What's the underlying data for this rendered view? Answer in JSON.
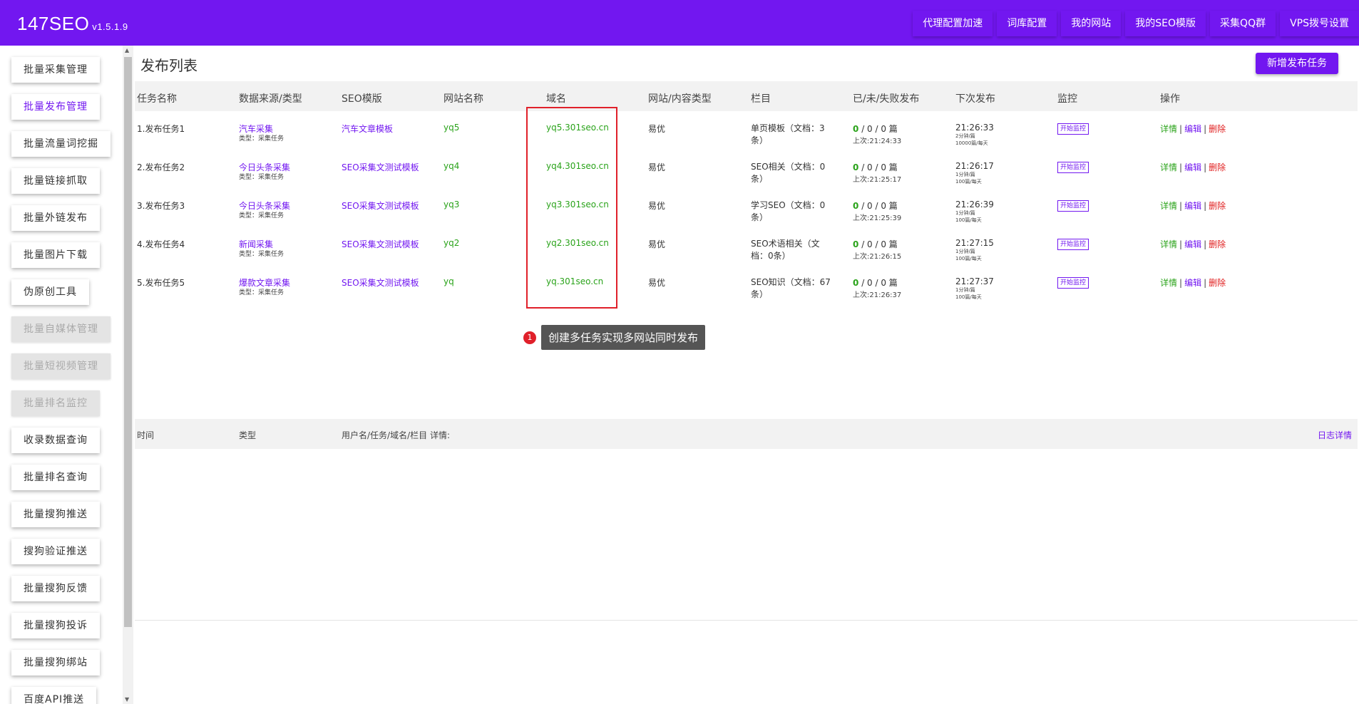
{
  "app": {
    "name": "147SEO",
    "version": "v1.5.1.9"
  },
  "topnav": [
    "代理配置加速",
    "词库配置",
    "我的网站",
    "我的SEO模版",
    "采集QQ群",
    "VPS拨号设置"
  ],
  "sidebar": [
    {
      "label": "批量采集管理",
      "state": "normal"
    },
    {
      "label": "批量发布管理",
      "state": "active"
    },
    {
      "label": "批量流量词挖掘",
      "state": "normal"
    },
    {
      "label": "批量链接抓取",
      "state": "normal"
    },
    {
      "label": "批量外链发布",
      "state": "normal"
    },
    {
      "label": "批量图片下载",
      "state": "normal"
    },
    {
      "label": "伪原创工具",
      "state": "normal"
    },
    {
      "label": "批量自媒体管理",
      "state": "disabled"
    },
    {
      "label": "批量短视频管理",
      "state": "disabled"
    },
    {
      "label": "批量排名监控",
      "state": "disabled"
    },
    {
      "label": "收录数据查询",
      "state": "normal"
    },
    {
      "label": "批量排名查询",
      "state": "normal"
    },
    {
      "label": "批量搜狗推送",
      "state": "normal"
    },
    {
      "label": "搜狗验证推送",
      "state": "normal"
    },
    {
      "label": "批量搜狗反馈",
      "state": "normal"
    },
    {
      "label": "批量搜狗投诉",
      "state": "normal"
    },
    {
      "label": "批量搜狗绑站",
      "state": "normal"
    },
    {
      "label": "百度API推送",
      "state": "normal"
    }
  ],
  "main": {
    "title": "发布列表",
    "add_button": "新增发布任务",
    "columns": [
      "任务名称",
      "数据来源/类型",
      "SEO模版",
      "网站名称",
      "域名",
      "网站/内容类型",
      "栏目",
      "已/未/失败发布",
      "下次发布",
      "监控",
      "操作"
    ],
    "rows": [
      {
        "task": "1.发布任务1",
        "source": "汽车采集",
        "source_type": "类型：采集任务",
        "template": "汽车文章模板",
        "site": "yq5",
        "domain": "yq5.301seo.cn",
        "content_type": "易优",
        "column_l1": "单页模板（文档：3",
        "column_l2": "条）",
        "pub_ok": "0",
        "pub_rest": "/ 0 / 0 篇",
        "last": "上次:21:24:33",
        "next": "21:26:33",
        "freq1": "2分钟/篇",
        "freq2": "10000篇/每天",
        "monitor": "开始监控",
        "op_detail": "详情",
        "op_edit": "编辑",
        "op_delete": "删除"
      },
      {
        "task": "2.发布任务2",
        "source": "今日头条采集",
        "source_type": "类型：采集任务",
        "template": "SEO采集文测试模板",
        "site": "yq4",
        "domain": "yq4.301seo.cn",
        "content_type": "易优",
        "column_l1": "SEO相关（文档：0",
        "column_l2": "条）",
        "pub_ok": "0",
        "pub_rest": "/ 0 / 0 篇",
        "last": "上次:21:25:17",
        "next": "21:26:17",
        "freq1": "1分钟/篇",
        "freq2": "100篇/每天",
        "monitor": "开始监控",
        "op_detail": "详情",
        "op_edit": "编辑",
        "op_delete": "删除"
      },
      {
        "task": "3.发布任务3",
        "source": "今日头条采集",
        "source_type": "类型：采集任务",
        "template": "SEO采集文测试模板",
        "site": "yq3",
        "domain": "yq3.301seo.cn",
        "content_type": "易优",
        "column_l1": "学习SEO（文档：0",
        "column_l2": "条）",
        "pub_ok": "0",
        "pub_rest": "/ 0 / 0 篇",
        "last": "上次:21:25:39",
        "next": "21:26:39",
        "freq1": "1分钟/篇",
        "freq2": "100篇/每天",
        "monitor": "开始监控",
        "op_detail": "详情",
        "op_edit": "编辑",
        "op_delete": "删除"
      },
      {
        "task": "4.发布任务4",
        "source": "新闻采集",
        "source_type": "类型：采集任务",
        "template": "SEO采集文测试模板",
        "site": "yq2",
        "domain": "yq2.301seo.cn",
        "content_type": "易优",
        "column_l1": "SEO术语相关（文",
        "column_l2": "档：0条）",
        "pub_ok": "0",
        "pub_rest": "/ 0 / 0 篇",
        "last": "上次:21:26:15",
        "next": "21:27:15",
        "freq1": "1分钟/篇",
        "freq2": "100篇/每天",
        "monitor": "开始监控",
        "op_detail": "详情",
        "op_edit": "编辑",
        "op_delete": "删除"
      },
      {
        "task": "5.发布任务5",
        "source": "爆款文章采集",
        "source_type": "类型：采集任务",
        "template": "SEO采集文测试模板",
        "site": "yq",
        "domain": "yq.301seo.cn",
        "content_type": "易优",
        "column_l1": "SEO知识（文档：67",
        "column_l2": "条）",
        "pub_ok": "0",
        "pub_rest": "/ 0 / 0 篇",
        "last": "上次:21:26:37",
        "next": "21:27:37",
        "freq1": "1分钟/篇",
        "freq2": "100篇/每天",
        "monitor": "开始监控",
        "op_detail": "详情",
        "op_edit": "编辑",
        "op_delete": "删除"
      }
    ]
  },
  "callout": {
    "number": "1",
    "text": "创建多任务实现多网站同时发布"
  },
  "log": {
    "columns": [
      "时间",
      "类型",
      "用户名/任务/域名/栏目 详情:"
    ],
    "detail_link": "日志详情"
  }
}
